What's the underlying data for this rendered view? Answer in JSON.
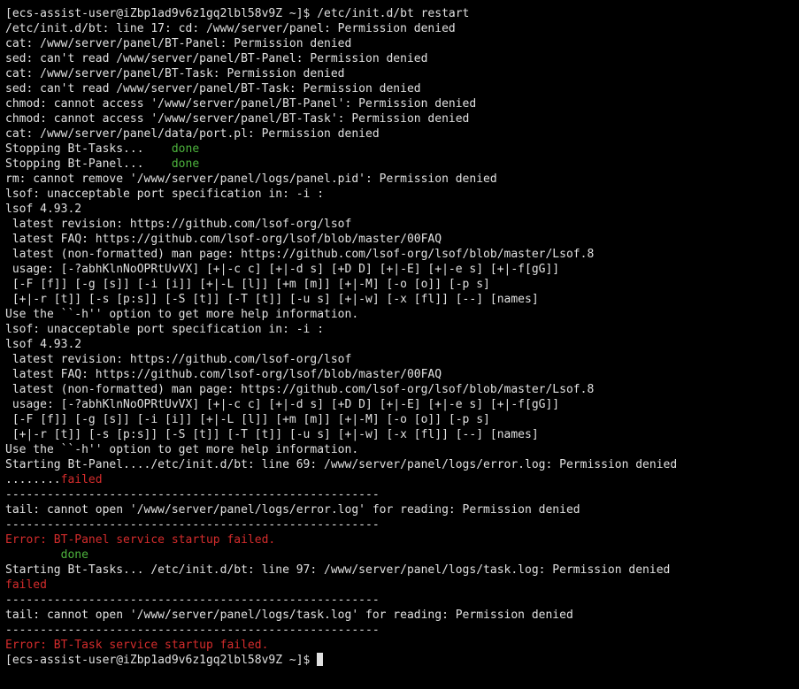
{
  "colors": {
    "background": "#000000",
    "text": "#e0e0e0",
    "done": "#4db33d",
    "error": "#d42c2c"
  },
  "terminal": {
    "lines": [
      [
        {
          "t": "[ecs-assist-user@iZbp1ad9v6z1gq2lbl58v9Z ~]$ /etc/init.d/bt restart"
        }
      ],
      [
        {
          "t": "/etc/init.d/bt: line 17: cd: /www/server/panel: Permission denied"
        }
      ],
      [
        {
          "t": "cat: /www/server/panel/BT-Panel: Permission denied"
        }
      ],
      [
        {
          "t": "sed: can't read /www/server/panel/BT-Panel: Permission denied"
        }
      ],
      [
        {
          "t": "cat: /www/server/panel/BT-Task: Permission denied"
        }
      ],
      [
        {
          "t": "sed: can't read /www/server/panel/BT-Task: Permission denied"
        }
      ],
      [
        {
          "t": "chmod: cannot access '/www/server/panel/BT-Panel': Permission denied"
        }
      ],
      [
        {
          "t": "chmod: cannot access '/www/server/panel/BT-Task': Permission denied"
        }
      ],
      [
        {
          "t": "cat: /www/server/panel/data/port.pl: Permission denied"
        }
      ],
      [
        {
          "t": "Stopping Bt-Tasks...    "
        },
        {
          "t": "done",
          "c": "done"
        }
      ],
      [
        {
          "t": "Stopping Bt-Panel...    "
        },
        {
          "t": "done",
          "c": "done"
        }
      ],
      [
        {
          "t": "rm: cannot remove '/www/server/panel/logs/panel.pid': Permission denied"
        }
      ],
      [
        {
          "t": "lsof: unacceptable port specification in: -i :"
        }
      ],
      [
        {
          "t": "lsof 4.93.2"
        }
      ],
      [
        {
          "t": " latest revision: https://github.com/lsof-org/lsof"
        }
      ],
      [
        {
          "t": " latest FAQ: https://github.com/lsof-org/lsof/blob/master/00FAQ"
        }
      ],
      [
        {
          "t": " latest (non-formatted) man page: https://github.com/lsof-org/lsof/blob/master/Lsof.8"
        }
      ],
      [
        {
          "t": " usage: [-?abhKlnNoOPRtUvVX] [+|-c c] [+|-d s] [+D D] [+|-E] [+|-e s] [+|-f[gG]]"
        }
      ],
      [
        {
          "t": " [-F [f]] [-g [s]] [-i [i]] [+|-L [l]] [+m [m]] [+|-M] [-o [o]] [-p s]"
        }
      ],
      [
        {
          "t": " [+|-r [t]] [-s [p:s]] [-S [t]] [-T [t]] [-u s] [+|-w] [-x [fl]] [--] [names]"
        }
      ],
      [
        {
          "t": "Use the ``-h'' option to get more help information."
        }
      ],
      [
        {
          "t": "lsof: unacceptable port specification in: -i :"
        }
      ],
      [
        {
          "t": "lsof 4.93.2"
        }
      ],
      [
        {
          "t": " latest revision: https://github.com/lsof-org/lsof"
        }
      ],
      [
        {
          "t": " latest FAQ: https://github.com/lsof-org/lsof/blob/master/00FAQ"
        }
      ],
      [
        {
          "t": " latest (non-formatted) man page: https://github.com/lsof-org/lsof/blob/master/Lsof.8"
        }
      ],
      [
        {
          "t": " usage: [-?abhKlnNoOPRtUvVX] [+|-c c] [+|-d s] [+D D] [+|-E] [+|-e s] [+|-f[gG]]"
        }
      ],
      [
        {
          "t": " [-F [f]] [-g [s]] [-i [i]] [+|-L [l]] [+m [m]] [+|-M] [-o [o]] [-p s]"
        }
      ],
      [
        {
          "t": " [+|-r [t]] [-s [p:s]] [-S [t]] [-T [t]] [-u s] [+|-w] [-x [fl]] [--] [names]"
        }
      ],
      [
        {
          "t": "Use the ``-h'' option to get more help information."
        }
      ],
      [
        {
          "t": "Starting Bt-Panel..../etc/init.d/bt: line 69: /www/server/panel/logs/error.log: Permission denied"
        }
      ],
      [
        {
          "t": "........"
        },
        {
          "t": "failed",
          "c": "error"
        }
      ],
      [
        {
          "t": "------------------------------------------------------"
        }
      ],
      [
        {
          "t": "tail: cannot open '/www/server/panel/logs/error.log' for reading: Permission denied"
        }
      ],
      [
        {
          "t": "------------------------------------------------------"
        }
      ],
      [
        {
          "t": "Error: BT-Panel service startup failed.",
          "c": "error"
        }
      ],
      [
        {
          "t": "        "
        },
        {
          "t": "done",
          "c": "done"
        }
      ],
      [
        {
          "t": "Starting Bt-Tasks... /etc/init.d/bt: line 97: /www/server/panel/logs/task.log: Permission denied"
        }
      ],
      [
        {
          "t": "failed",
          "c": "error"
        }
      ],
      [
        {
          "t": "------------------------------------------------------"
        }
      ],
      [
        {
          "t": "tail: cannot open '/www/server/panel/logs/task.log' for reading: Permission denied"
        }
      ],
      [
        {
          "t": "------------------------------------------------------"
        }
      ],
      [
        {
          "t": "Error: BT-Task service startup failed.",
          "c": "error"
        }
      ]
    ],
    "prompt": "[ecs-assist-user@iZbp1ad9v6z1gq2lbl58v9Z ~]$ "
  }
}
